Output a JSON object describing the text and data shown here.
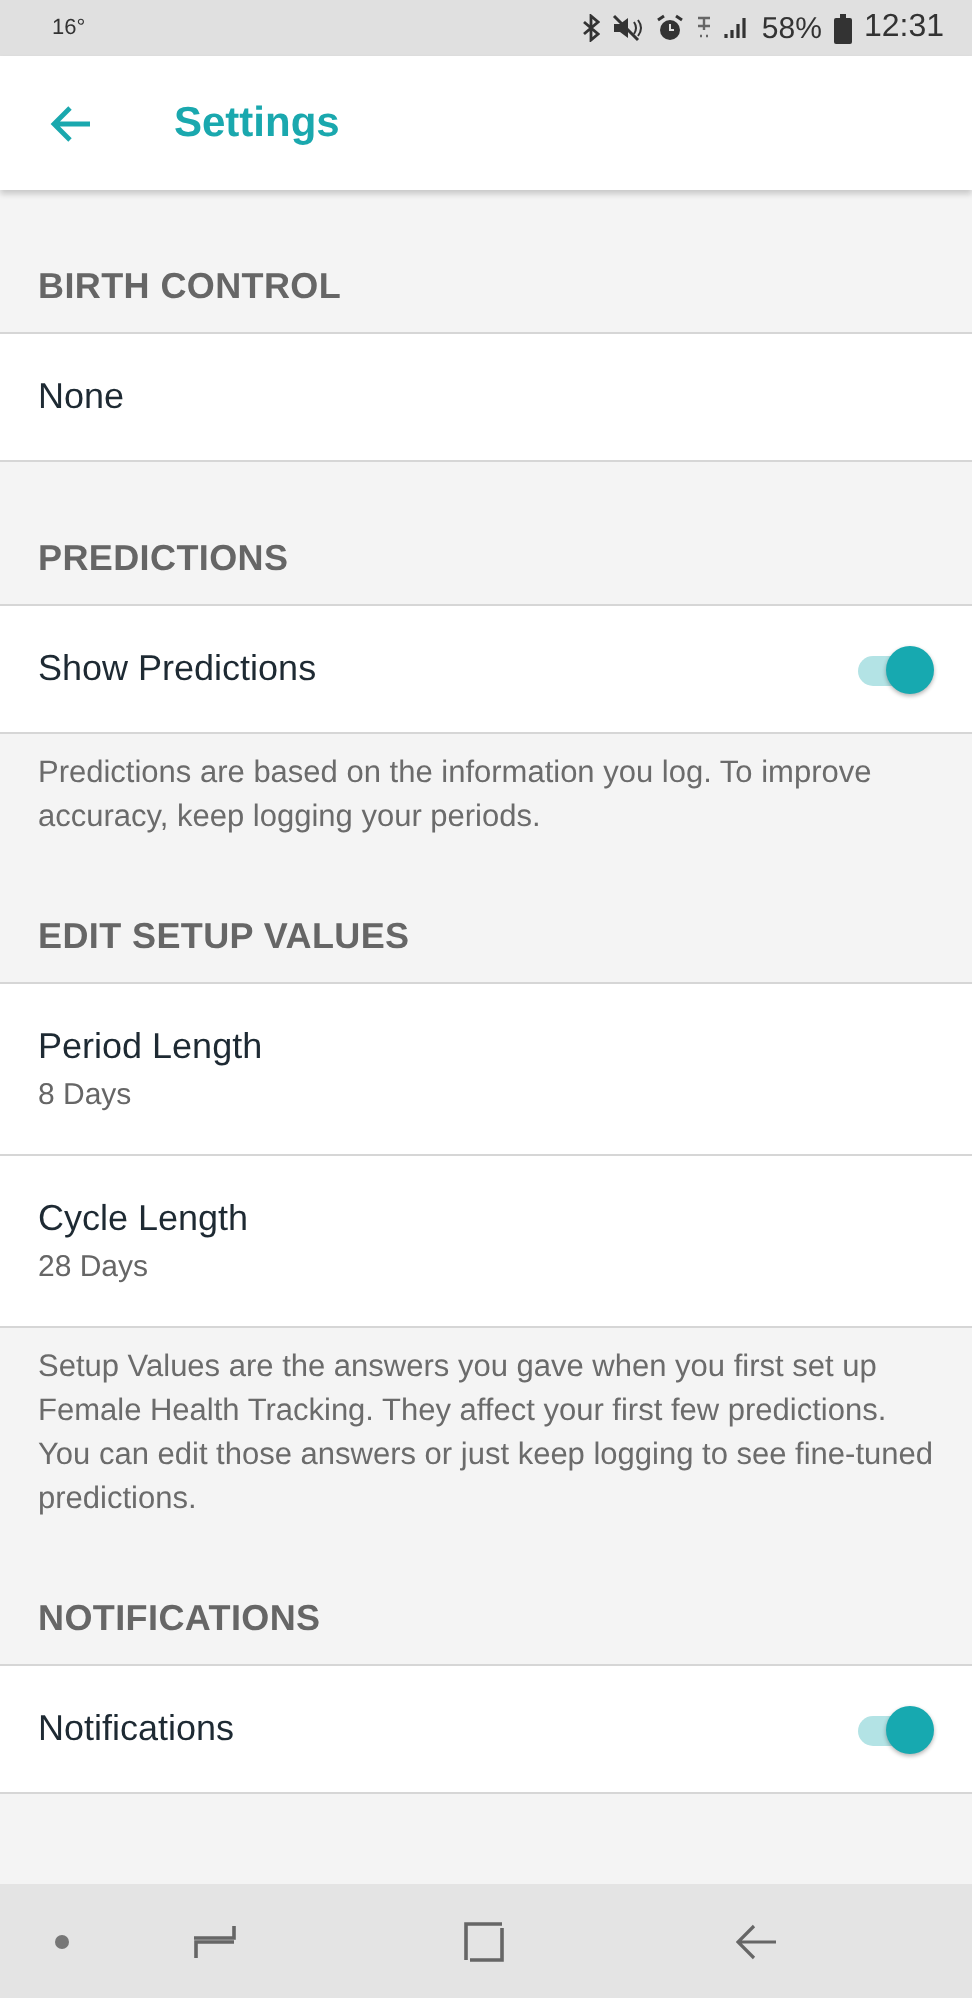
{
  "status_bar": {
    "temperature": "16°",
    "battery": "58%",
    "time": "12:31"
  },
  "app_bar": {
    "title": "Settings"
  },
  "sections": [
    {
      "header": "BIRTH CONTROL",
      "rows": [
        {
          "kind": "plain",
          "label": "None"
        }
      ]
    },
    {
      "header": "PREDICTIONS",
      "rows": [
        {
          "kind": "toggle",
          "label": "Show Predictions",
          "on": true
        }
      ],
      "note": "Predictions are based on the information you log. To improve accuracy, keep logging your periods."
    },
    {
      "header": "EDIT SETUP VALUES",
      "rows": [
        {
          "kind": "value",
          "label": "Period Length",
          "value": "8 Days"
        },
        {
          "kind": "value",
          "label": "Cycle Length",
          "value": "28 Days"
        }
      ],
      "note": "Setup Values are the answers you gave when you first set up Female Health Tracking. They affect your first few predictions. You can edit those answers or just keep logging to see fine-tuned predictions."
    },
    {
      "header": "NOTIFICATIONS",
      "rows": [
        {
          "kind": "toggle",
          "label": "Notifications",
          "on": true
        }
      ]
    }
  ]
}
